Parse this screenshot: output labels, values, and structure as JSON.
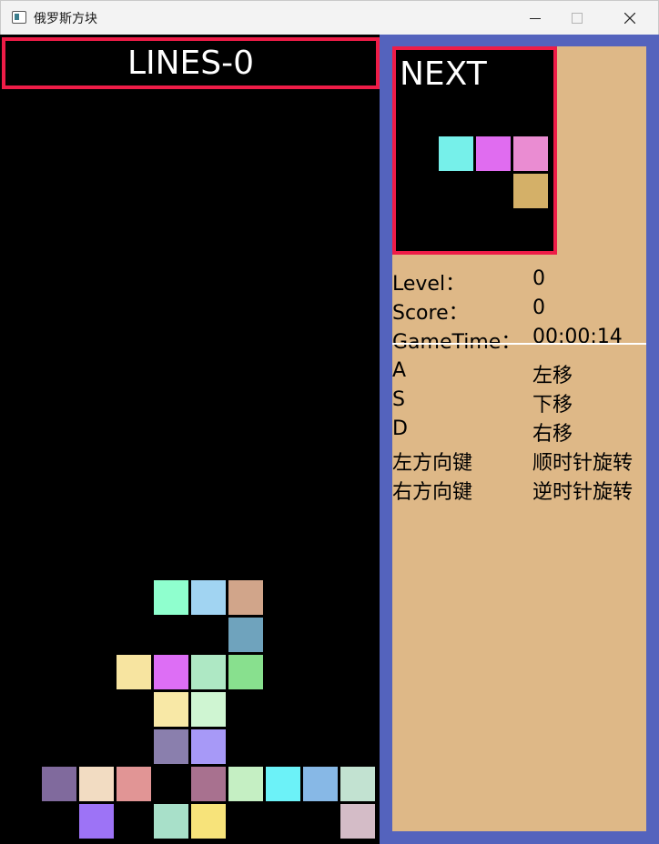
{
  "window": {
    "title": "俄罗斯方块",
    "buttons": [
      "minimize",
      "maximize",
      "close"
    ]
  },
  "board": {
    "lines_label": "LINES-0",
    "columns": 10,
    "rows": 21,
    "cells": [
      {
        "col": 4,
        "row": 14,
        "color": "#8fffce"
      },
      {
        "col": 5,
        "row": 14,
        "color": "#a1d4f2"
      },
      {
        "col": 6,
        "row": 14,
        "color": "#d1a58a"
      },
      {
        "col": 6,
        "row": 15,
        "color": "#6fa3bd"
      },
      {
        "col": 3,
        "row": 16,
        "color": "#f7e4a0"
      },
      {
        "col": 4,
        "row": 16,
        "color": "#dd6ef5"
      },
      {
        "col": 5,
        "row": 16,
        "color": "#aee8c4"
      },
      {
        "col": 6,
        "row": 16,
        "color": "#88e08e"
      },
      {
        "col": 4,
        "row": 17,
        "color": "#f8e8a6"
      },
      {
        "col": 5,
        "row": 17,
        "color": "#cff5d2"
      },
      {
        "col": 4,
        "row": 18,
        "color": "#8a7fad"
      },
      {
        "col": 5,
        "row": 18,
        "color": "#a799f7"
      },
      {
        "col": 1,
        "row": 19,
        "color": "#806a9d"
      },
      {
        "col": 2,
        "row": 19,
        "color": "#f2dcc2"
      },
      {
        "col": 3,
        "row": 19,
        "color": "#e19595"
      },
      {
        "col": 5,
        "row": 19,
        "color": "#a8718f"
      },
      {
        "col": 6,
        "row": 19,
        "color": "#c5efc3"
      },
      {
        "col": 7,
        "row": 19,
        "color": "#6cf2f8"
      },
      {
        "col": 8,
        "row": 19,
        "color": "#87b8e6"
      },
      {
        "col": 9,
        "row": 19,
        "color": "#c2e2d1"
      },
      {
        "col": 2,
        "row": 20,
        "color": "#9d73f6"
      },
      {
        "col": 4,
        "row": 20,
        "color": "#a8e0c9"
      },
      {
        "col": 5,
        "row": 20,
        "color": "#f7e37a"
      },
      {
        "col": 9,
        "row": 20,
        "color": "#d4bcc7"
      }
    ]
  },
  "next": {
    "label": "NEXT",
    "cells": [
      {
        "col": 0,
        "row": 0,
        "color": "#76f0ea"
      },
      {
        "col": 1,
        "row": 0,
        "color": "#e06cf0"
      },
      {
        "col": 2,
        "row": 0,
        "color": "#ea8cd2"
      },
      {
        "col": 2,
        "row": 1,
        "color": "#d4b068"
      }
    ]
  },
  "stats": [
    {
      "label": "Level：",
      "value": "0"
    },
    {
      "label": "Score：",
      "value": "0"
    },
    {
      "label": "GameTime：",
      "value": "00:00:14"
    }
  ],
  "controls": [
    {
      "key": "A",
      "action": "左移"
    },
    {
      "key": "S",
      "action": "下移"
    },
    {
      "key": "D",
      "action": "右移"
    },
    {
      "key": "左方向键",
      "action": "顺时针旋转"
    },
    {
      "key": "右方向键",
      "action": "逆时针旋转"
    }
  ],
  "colors": {
    "frame": "#5463bd",
    "panel": "#deb887",
    "highlight_border": "#ee1c47",
    "board_bg": "#000000"
  }
}
